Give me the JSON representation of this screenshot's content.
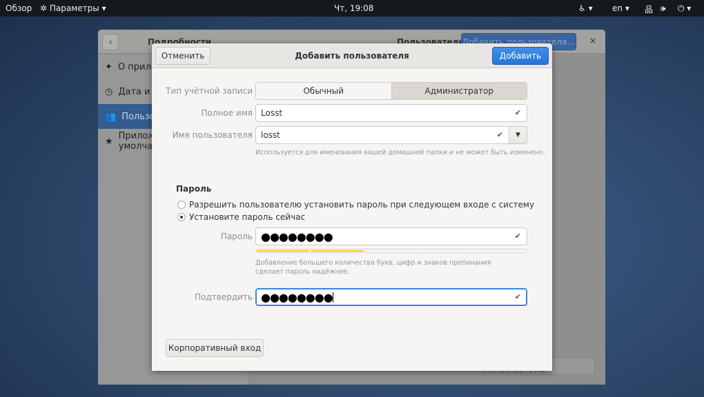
{
  "topbar": {
    "overview": "Обзор",
    "app_menu": "Параметры",
    "clock": "Чт, 19:08",
    "lang": "en"
  },
  "settings": {
    "back_title": "Подробности",
    "panel_title": "Пользователи",
    "add_user": "Добавить пользователя…",
    "close": "×",
    "sidebar": [
      {
        "label": "О приложении",
        "icon": "sparkle-icon"
      },
      {
        "label": "Дата и время",
        "icon": "clock-icon"
      },
      {
        "label": "Пользователи",
        "icon": "users-icon",
        "selected": true
      },
      {
        "label": "Приложения по умолчанию",
        "icon": "star-icon"
      }
    ],
    "bottom_button": "Добавить пользователя…"
  },
  "dialog": {
    "cancel": "Отменить",
    "title": "Добавить пользователя",
    "add": "Добавить",
    "account_type_label": "Тип учётной записи",
    "account_types": [
      "Обычный",
      "Администратор"
    ],
    "account_type_selected": "Обычный",
    "fullname_label": "Полное имя",
    "fullname_value": "Losst",
    "username_label": "Имя пользователя",
    "username_value": "losst",
    "username_hint": "Используется для именования вашей домашней папки и не может быть изменено.",
    "password_section": "Пароль",
    "radio_later": "Разрешить пользователю установить пароль при следующем входе с систему",
    "radio_now": "Установите пароль сейчас",
    "radio_selected": "now",
    "password_label": "Пароль",
    "password_value": "●●●●●●●●",
    "strength_level": 2,
    "strength_max": 5,
    "strength_color": "#f5c211",
    "password_hint": "Добавление большего количества букв, цифр и знаков препинания сделает пароль надёжнее.",
    "confirm_label": "Подтвердить",
    "confirm_value": "●●●●●●●●",
    "enterprise_login": "Корпоративный вход"
  }
}
